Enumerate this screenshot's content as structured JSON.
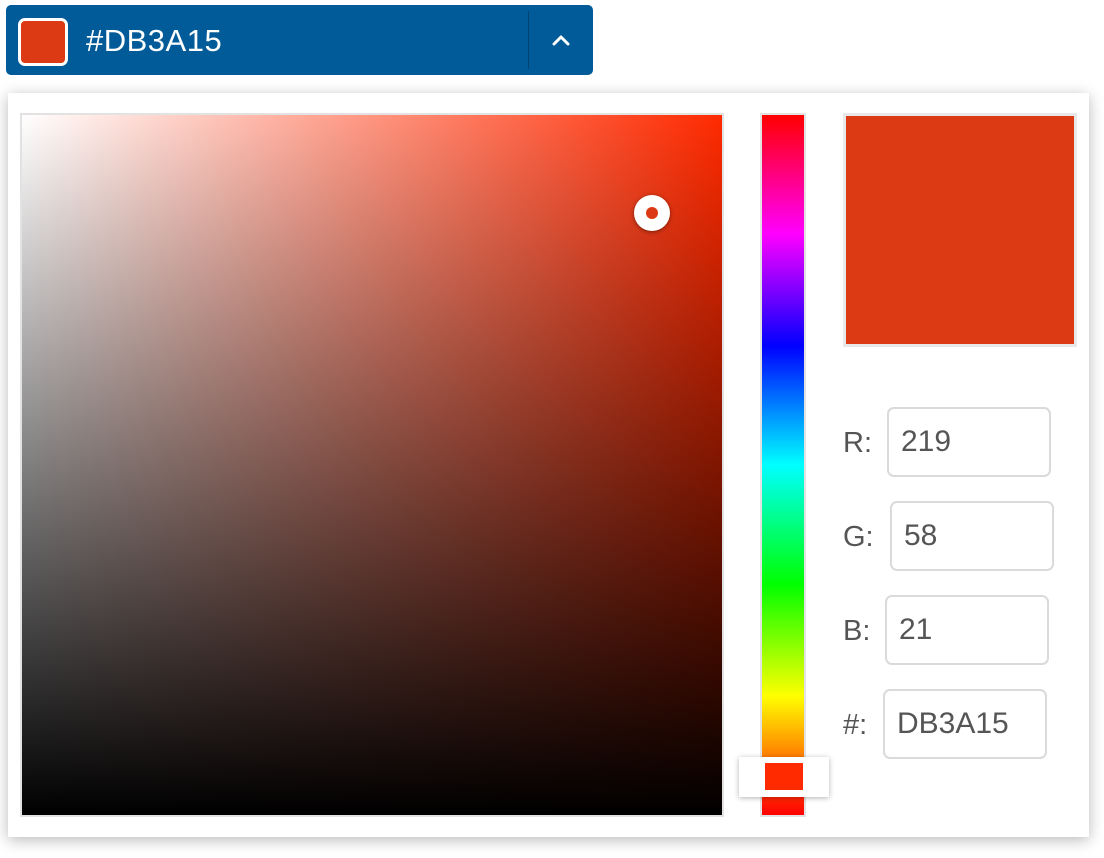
{
  "toggle": {
    "label": "#DB3A15",
    "chevron_icon": "chevron-up-icon"
  },
  "colors": {
    "selected": "#DB3A15",
    "toggle_bg": "#005B98",
    "hue_pure": "#FF2A00"
  },
  "picker": {
    "saturation": 0.9,
    "value": 0.86,
    "hue_degrees": 11
  },
  "channels": {
    "r_label": "R:",
    "r_value": "219",
    "g_label": "G:",
    "g_value": "58",
    "b_label": "B:",
    "b_value": "21",
    "hex_label": "#:",
    "hex_value": "DB3A15"
  }
}
